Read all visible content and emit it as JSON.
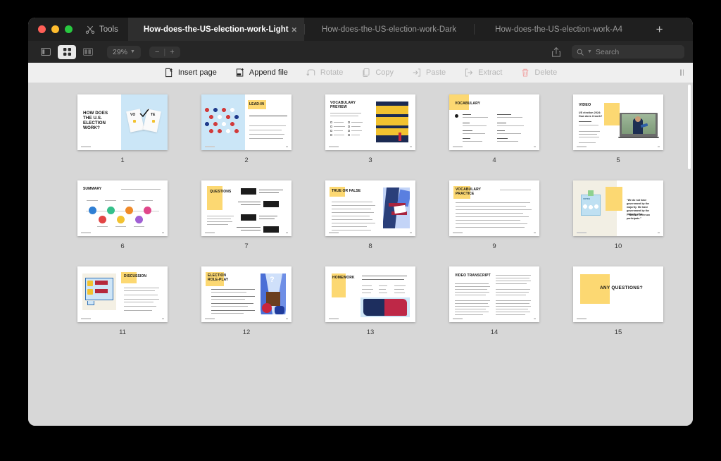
{
  "window": {
    "traffic_lights": [
      "close",
      "minimize",
      "maximize"
    ],
    "tools_label": "Tools",
    "new_tab_label": "+",
    "tabs": [
      {
        "label": "How-does-the-US-election-work-Light",
        "active": true,
        "close": "×"
      },
      {
        "label": "How-does-the-US-election-work-Dark",
        "active": false
      },
      {
        "label": "How-does-the-US-election-work-A4",
        "active": false
      }
    ]
  },
  "toolbar": {
    "sidebar_icon": "sidebar-icon",
    "grid_view_icon": "grid-view-icon",
    "split_view_icon": "split-view-icon",
    "zoom_level": "29%",
    "zoom_chevron": "⌄",
    "zoom_out": "−",
    "zoom_divider": "|",
    "zoom_in": "+",
    "share_icon": "share-icon",
    "search_icon": "search-icon",
    "search_placeholder": "Search",
    "search_value": ""
  },
  "actionbar": {
    "items": [
      {
        "label": "Insert page",
        "icon": "insert-page-icon",
        "disabled": false
      },
      {
        "label": "Append file",
        "icon": "append-file-icon",
        "disabled": false
      },
      {
        "label": "Rotate",
        "icon": "rotate-icon",
        "disabled": true
      },
      {
        "label": "Copy",
        "icon": "copy-icon",
        "disabled": true
      },
      {
        "label": "Paste",
        "icon": "paste-icon",
        "disabled": true
      },
      {
        "label": "Extract",
        "icon": "extract-icon",
        "disabled": true
      },
      {
        "label": "Delete",
        "icon": "delete-icon",
        "disabled": true
      }
    ],
    "delete_color": "#f29b9b",
    "grip_icon": "drag-grip-icon"
  },
  "pages": [
    {
      "number": "1",
      "kind": "title",
      "title": "HOW DOES THE U.S. ELECTION WORK?"
    },
    {
      "number": "2",
      "kind": "lead-in",
      "title": "LEAD-IN"
    },
    {
      "number": "3",
      "kind": "vocabulary-preview",
      "title": "VOCABULARY PREVIEW"
    },
    {
      "number": "4",
      "kind": "vocabulary",
      "title": "VOCABULARY"
    },
    {
      "number": "5",
      "kind": "video",
      "title": "VIDEO"
    },
    {
      "number": "6",
      "kind": "summary",
      "title": "SUMMARY"
    },
    {
      "number": "7",
      "kind": "questions",
      "title": "QUESTIONS"
    },
    {
      "number": "8",
      "kind": "true-or-false",
      "title": "TRUE OR FALSE"
    },
    {
      "number": "9",
      "kind": "vocabulary-practice",
      "title": "VOCABULARY PRACTICE"
    },
    {
      "number": "10",
      "kind": "quote",
      "title": ""
    },
    {
      "number": "11",
      "kind": "discussion",
      "title": "DISCUSSION"
    },
    {
      "number": "12",
      "kind": "election-role-play",
      "title": "ELECTION ROLE-PLAY"
    },
    {
      "number": "13",
      "kind": "homework",
      "title": "HOMEWORK"
    },
    {
      "number": "14",
      "kind": "video-transcript",
      "title": "VIDEO TRANSCRIPT"
    },
    {
      "number": "15",
      "kind": "any-questions",
      "title": "ANY QUESTIONS?"
    }
  ],
  "slide_text": {
    "p1_title": "HOW DOES THE U.S. ELECTION WORK?",
    "p1_vote_left": "VO",
    "p1_vote_right": "TE",
    "p5_sub1": "US election 2024:",
    "p5_sub2": "How does it work?",
    "p5_sub3": "Duration: 2:41 min",
    "p10_quote": "“We do not have government by the majority. We have government by the majority who participate.”",
    "p10_attrib": "- Thomas Jefferson",
    "p15_title": "ANY QUESTIONS?"
  },
  "colors": {
    "accent_yellow": "#fcd872",
    "light_blue": "#cbe6f7",
    "navy": "#1f3864",
    "red": "#c9253c",
    "window_bg": "#d7d7d7",
    "titlebar": "#1f1f1f",
    "toolbar": "#262626",
    "actionbar": "#efefef"
  }
}
